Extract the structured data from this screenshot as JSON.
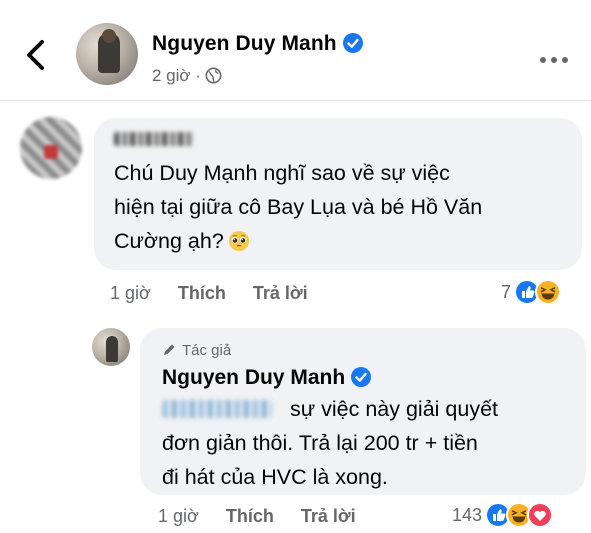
{
  "post": {
    "author_name": "Nguyen Duy Manh",
    "time": "2 giờ",
    "separator": "·"
  },
  "comment": {
    "text_line1": "Chú Duy Mạnh nghĩ sao về sự việc",
    "text_line2": "hiện tại giữa cô Bay Lụa và bé Hồ Văn",
    "text_line3": "Cường ạh?",
    "emoji": "pleading-face-emoji",
    "time": "1 giờ",
    "like_label": "Thích",
    "reply_label": "Trả lời",
    "reaction_count": "7"
  },
  "reply": {
    "author_tag": "Tác giả",
    "author_name": "Nguyen Duy Manh",
    "text_line1": "sự việc này giải quyết",
    "text_line2": "đơn giản thôi. Trả lại 200 tr + tiền",
    "text_line3": "đi hát của HVC là xong.",
    "time": "1 giờ",
    "like_label": "Thích",
    "reply_label": "Trả lời",
    "reaction_count": "143"
  },
  "colors": {
    "facebook_blue": "#1877f2",
    "bubble_bg": "#f0f2f5",
    "secondary_text": "#65676b",
    "love_red": "#f33e58",
    "haha_yellow": "#f7b125"
  }
}
